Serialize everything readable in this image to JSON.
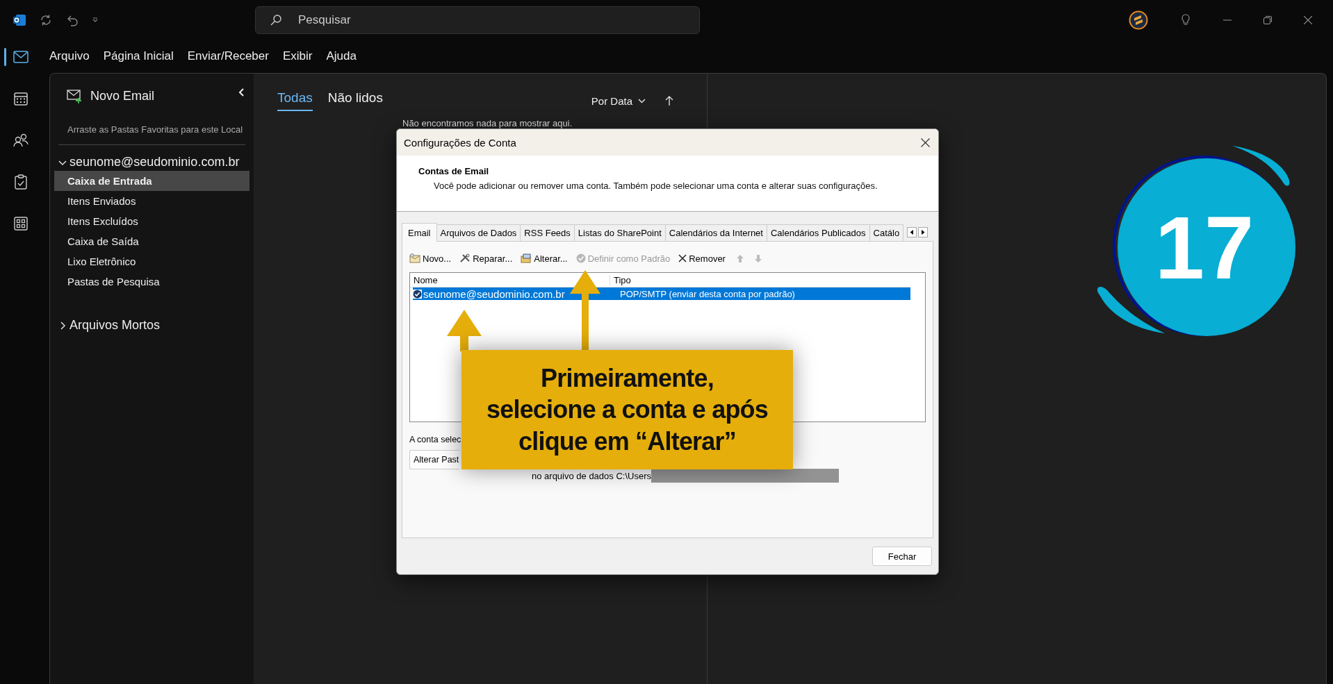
{
  "title_bar": {
    "search_placeholder": "Pesquisar"
  },
  "rail": [
    {
      "kind": "mail",
      "selected": true
    },
    {
      "kind": "calendar",
      "selected": false
    },
    {
      "kind": "people",
      "selected": false
    },
    {
      "kind": "tasks",
      "selected": false
    },
    {
      "kind": "apps",
      "selected": false
    }
  ],
  "menu": [
    "Arquivo",
    "Página Inicial",
    "Enviar/Receber",
    "Exibir",
    "Ajuda"
  ],
  "folder_pane": {
    "new_button": "Novo Email",
    "favorites_hint": "Arraste as Pastas Favoritas para este Local",
    "accounts": [
      {
        "name": "seunome@seudominio.com.br",
        "expanded": true,
        "children": [
          {
            "name": "Caixa de Entrada",
            "selected": true
          },
          {
            "name": "Itens Enviados",
            "selected": false
          },
          {
            "name": "Itens Excluídos",
            "selected": false
          },
          {
            "name": "Caixa de Saída",
            "selected": false
          },
          {
            "name": "Lixo Eletrônico",
            "selected": false
          },
          {
            "name": "Pastas de Pesquisa",
            "selected": false
          }
        ]
      },
      {
        "name": "Arquivos Mortos",
        "expanded": false
      }
    ]
  },
  "message_list": {
    "tabs": [
      {
        "label": "Todas",
        "selected": true
      },
      {
        "label": "Não lidos",
        "selected": false
      }
    ],
    "sort": "Por Data",
    "empty_text": "Não encontramos nada para mostrar aqui."
  },
  "dialog": {
    "title": "Configurações de Conta",
    "heading": "Contas de Email",
    "description": "Você pode adicionar ou remover uma conta. Também pode selecionar uma conta e alterar suas configurações.",
    "tabs": [
      {
        "label": "Email",
        "selected": true
      },
      {
        "label": "Arquivos de Dados",
        "selected": false
      },
      {
        "label": "RSS Feeds",
        "selected": false
      },
      {
        "label": "Listas do SharePoint",
        "selected": false
      },
      {
        "label": "Calendários da Internet",
        "selected": false
      },
      {
        "label": "Calendários Publicados",
        "selected": false
      },
      {
        "label": "Catálo",
        "selected": false
      }
    ],
    "toolbar": [
      {
        "kind": "new",
        "label": "Novo...",
        "disabled": false
      },
      {
        "kind": "repair",
        "label": "Reparar...",
        "disabled": false
      },
      {
        "kind": "change",
        "label": "Alterar...",
        "disabled": false
      },
      {
        "kind": "default",
        "label": "Definir como Padrão",
        "disabled": true
      },
      {
        "kind": "remove",
        "label": "Remover",
        "disabled": false
      },
      {
        "kind": "up",
        "disabled": true
      },
      {
        "kind": "down",
        "disabled": true
      }
    ],
    "columns": [
      "Nome",
      "Tipo"
    ],
    "rows": [
      {
        "name": "seunome@seudominio.com.br",
        "type": "POP/SMTP (enviar desta conta por padrão)",
        "selected": true
      }
    ],
    "info_text": "A conta selec",
    "folder_button": "Alterar Past",
    "data_file_text": "no arquivo de dados C:\\Users",
    "close_button": "Fechar"
  },
  "callout": {
    "lines": [
      "Primeiramente,",
      "selecione a conta e após",
      "clique em “Alterar”"
    ]
  },
  "step_badge": "17"
}
